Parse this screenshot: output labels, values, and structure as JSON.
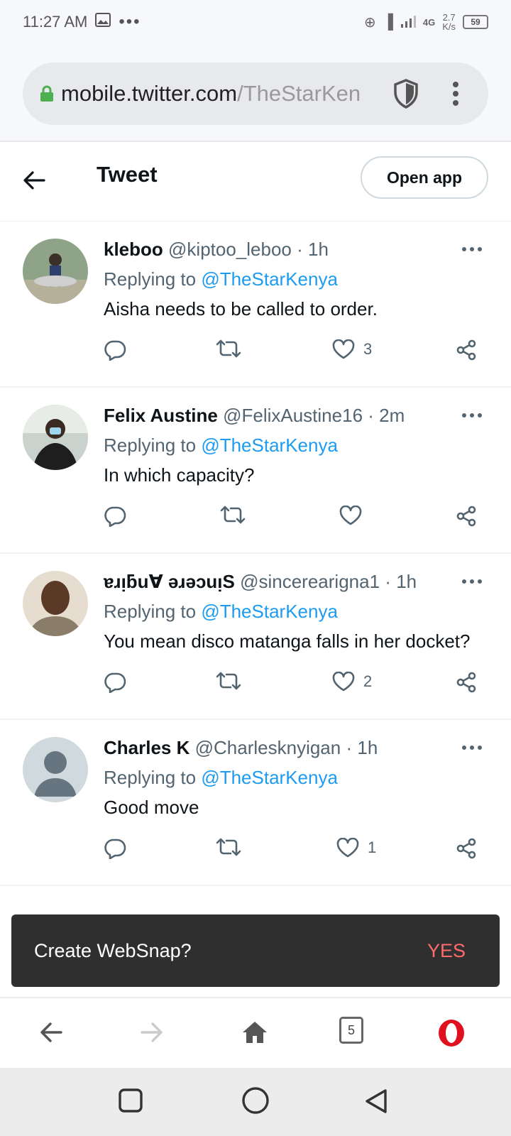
{
  "status_bar": {
    "time": "11:27 AM",
    "dots": "•••",
    "net": "4G",
    "speed_value": "2.7",
    "speed_unit": "K/s",
    "battery": "59"
  },
  "browser": {
    "url_domain": "mobile.twitter.com",
    "url_path": "/TheStarKen"
  },
  "header": {
    "title": "Tweet",
    "open_app_label": "Open app"
  },
  "replies": [
    {
      "name": "kleboo",
      "handle": "@kiptoo_leboo",
      "dot": "·",
      "time": "1h",
      "replying_label": "Replying to",
      "mention": "@TheStarKenya",
      "text": "Aisha needs to be called to order.",
      "likes": "3",
      "avatar_colors": [
        "#6d8a5a",
        "#2d3f6b"
      ]
    },
    {
      "name": "Felix Austine",
      "handle": "@FelixAustine16",
      "dot": "·",
      "time": "2m",
      "replying_label": "Replying to",
      "mention": "@TheStarKenya",
      "text": "In which capacity?",
      "likes": "",
      "avatar_colors": [
        "#3c3c3c",
        "#9aa6a0"
      ]
    },
    {
      "name": "ɐɹᴉƃu∀ ǝɹǝɔuᴉS",
      "handle": "@sincerearigna1",
      "dot": "·",
      "time": "1h",
      "replying_label": "Replying to",
      "mention": "@TheStarKenya",
      "text": "You mean disco matanga falls in her docket?",
      "likes": "2",
      "avatar_colors": [
        "#6b4a32",
        "#d8c9b0"
      ]
    },
    {
      "name": "Charles K",
      "handle": "@Charlesknyigan",
      "dot": "·",
      "time": "1h",
      "replying_label": "Replying to",
      "mention": "@TheStarKenya",
      "text": "Good move",
      "likes": "1",
      "avatar_colors": [
        "#cfd9de",
        "#66757f"
      ]
    }
  ],
  "snackbar": {
    "message": "Create WebSnap?",
    "action": "YES"
  },
  "browser_nav": {
    "tab_count": "5"
  },
  "colors": {
    "link": "#1d9bf0",
    "opera_red": "#e0101e",
    "snack_action": "#ff6b6b"
  }
}
